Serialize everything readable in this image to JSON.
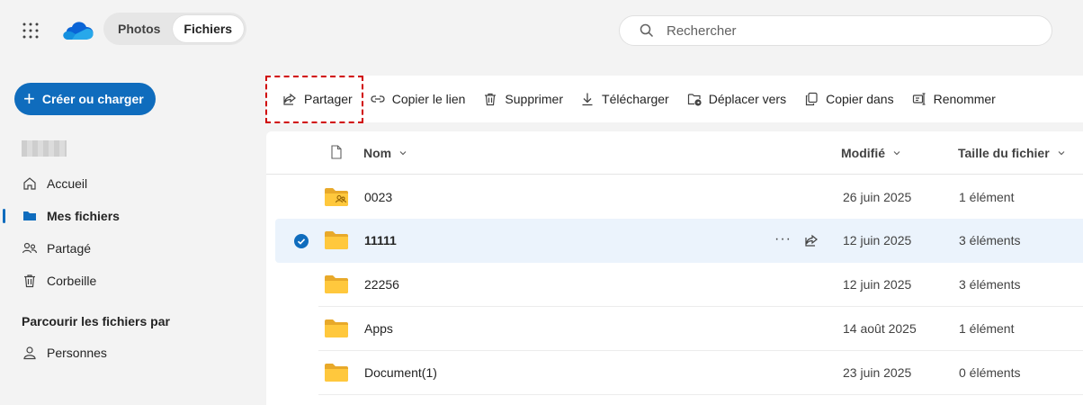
{
  "top": {
    "switch": {
      "photos": "Photos",
      "files": "Fichiers"
    },
    "search": {
      "placeholder": "Rechercher"
    }
  },
  "sidebar": {
    "create_label": "Créer ou charger",
    "items": [
      {
        "label": "Accueil",
        "icon": "home-icon"
      },
      {
        "label": "Mes fichiers",
        "icon": "folder-icon",
        "active": true
      },
      {
        "label": "Partagé",
        "icon": "people-icon"
      },
      {
        "label": "Corbeille",
        "icon": "trash-icon"
      }
    ],
    "browse_heading": "Parcourir les fichiers par",
    "browse_items": [
      {
        "label": "Personnes",
        "icon": "person-icon"
      }
    ]
  },
  "toolbar": {
    "share": "Partager",
    "copy_link": "Copier le lien",
    "delete": "Supprimer",
    "download": "Télécharger",
    "move_to": "Déplacer vers",
    "copy_to": "Copier dans",
    "rename": "Renommer"
  },
  "list": {
    "headers": {
      "name": "Nom",
      "modified": "Modifié",
      "size": "Taille du fichier"
    },
    "rows": [
      {
        "name": "0023",
        "modified": "26 juin 2025",
        "size": "1 élément",
        "shared": true
      },
      {
        "name": "11111",
        "modified": "12 juin 2025",
        "size": "3 éléments",
        "selected": true,
        "more": "···"
      },
      {
        "name": "22256",
        "modified": "12 juin 2025",
        "size": "3 éléments"
      },
      {
        "name": "Apps",
        "modified": "14 août 2025",
        "size": "1 élément"
      },
      {
        "name": "Document(1)",
        "modified": "23 juin 2025",
        "size": "0 éléments"
      }
    ]
  },
  "colors": {
    "accent": "#0f6cbd",
    "highlight": "#d00000",
    "folder": "#ffc83d",
    "selected_row": "#ebf3fc"
  }
}
